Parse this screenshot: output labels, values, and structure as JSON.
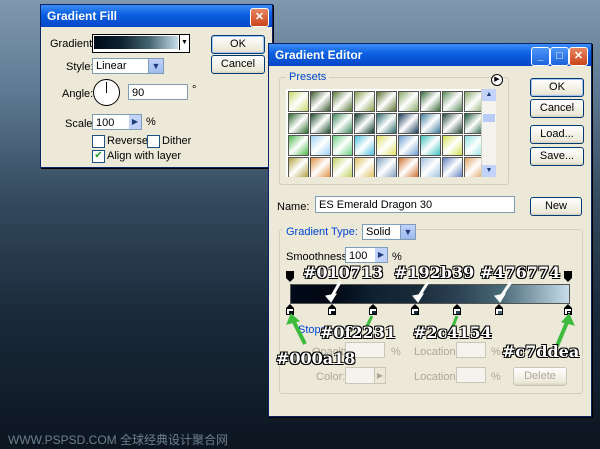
{
  "gradient_fill": {
    "title": "Gradient Fill",
    "gradient_label": "Gradient:",
    "style_label": "Style:",
    "style_value": "Linear",
    "angle_label": "Angle:",
    "angle_value": "90",
    "angle_unit": "°",
    "scale_label": "Scale:",
    "scale_value": "100",
    "scale_unit": "%",
    "reverse_label": "Reverse",
    "dither_label": "Dither",
    "align_label": "Align with layer",
    "reverse_checked": false,
    "dither_checked": false,
    "align_checked": true,
    "ok_label": "OK",
    "cancel_label": "Cancel"
  },
  "gradient_editor": {
    "title": "Gradient Editor",
    "presets_label": "Presets",
    "ok_label": "OK",
    "cancel_label": "Cancel",
    "load_label": "Load...",
    "save_label": "Save...",
    "name_label": "Name:",
    "name_value": "ES Emerald Dragon 30",
    "new_label": "New",
    "gradient_type_label": "Gradient Type:",
    "gradient_type_value": "Solid",
    "smoothness_label": "Smoothness:",
    "smoothness_value": "100",
    "smoothness_unit": "%",
    "stops_label": "Stops",
    "opacity_label": "Opacity:",
    "opacity_unit": "%",
    "location_label": "Location:",
    "location_unit": "%",
    "color_label": "Color:",
    "delete_label": "Delete"
  },
  "gradient_stops": [
    {
      "color": "#000a18",
      "location": 0
    },
    {
      "color": "#010713",
      "location": 15
    },
    {
      "color": "#0f2231",
      "location": 30
    },
    {
      "color": "#192b39",
      "location": 45
    },
    {
      "color": "#2c4154",
      "location": 60
    },
    {
      "color": "#476774",
      "location": 75
    },
    {
      "color": "#c7ddea",
      "location": 100
    }
  ],
  "annotations": {
    "c1": "#010713",
    "c2": "#192b39",
    "c3": "#476774",
    "c4": "#0f2231",
    "c5": "#2c4154",
    "c6": "#000a18",
    "c7": "#c7ddea"
  },
  "watermark": "WWW.PSPSD.COM 全球经典设计聚合网",
  "preset_colors": [
    [
      "#c8d86a",
      "#3c5a2e",
      "#5a7a3a",
      "#88a050",
      "#5a7030",
      "#8aa868",
      "#3a6a3a",
      "#5a8a5a",
      "#8aaa70",
      "#3a5a3a"
    ],
    [
      "#2e6a2e",
      "#1a4a2a",
      "#3a8a5a",
      "#0a3a2a",
      "#2a6a6a",
      "#1a3a5a",
      "#3a7a9a",
      "#2a4a3a",
      "#1a5a3a",
      "#3a8a4a"
    ],
    [
      "#4ab84a",
      "#9ad0f0",
      "#6ad080",
      "#4ac0e0",
      "#e0e060",
      "#6a9ad0",
      "#40c0c0",
      "#d0e050",
      "#8ae0e0",
      "#60a0e0"
    ],
    [
      "#b0a040",
      "#e09040",
      "#c0d060",
      "#e0c060",
      "#80a0c0",
      "#d07030",
      "#a0c0e0",
      "#6080c0",
      "#e0a060",
      "#c0e0f0"
    ]
  ]
}
